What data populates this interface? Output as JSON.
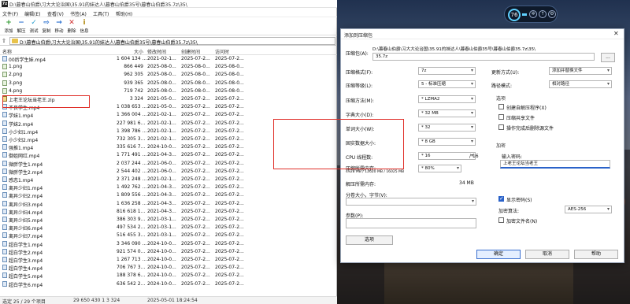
{
  "file_manager": {
    "title": "D:\\暮春山伯爵\\习大大论治国\\35.91的妹达人\\暮春山伯爵35号\\暮春山伯爵35.7z\\35\\",
    "menu": [
      "文件(F)",
      "编辑(E)",
      "查看(V)",
      "书签(A)",
      "工具(T)",
      "帮助(H)"
    ],
    "toolbar": [
      {
        "label": "添加",
        "icon": "add-icon",
        "color": "#2e9a2e",
        "glyph": "+"
      },
      {
        "label": "解压",
        "icon": "extract-icon",
        "color": "#2a6fcf",
        "glyph": "−"
      },
      {
        "label": "测试",
        "icon": "test-icon",
        "color": "#2a9fd0",
        "glyph": "✓"
      },
      {
        "label": "复制",
        "icon": "copy-icon",
        "color": "#2a6fcf",
        "glyph": "⇨"
      },
      {
        "label": "移动",
        "icon": "move-icon",
        "color": "#2a6fcf",
        "glyph": "→"
      },
      {
        "label": "删除",
        "icon": "delete-icon",
        "color": "#d03030",
        "glyph": "✕"
      },
      {
        "label": "信息",
        "icon": "info-icon",
        "color": "#b08a10",
        "glyph": "i"
      }
    ],
    "path": "D:\\暮春山伯爵\\习大大论治国\\35.91的妹达人\\暮春山伯爵35号\\暮春山伯爵35.7z\\35\\",
    "columns": {
      "name": "名称",
      "size": "大小",
      "modified": "修改时间",
      "created": "创建时间",
      "accessed": "访问时"
    },
    "rows": [
      {
        "name": "00后学生妹.mp4",
        "size": "1 604 134 ...",
        "modified": "2021-02-1...",
        "created": "2025-07-2...",
        "accessed": "2025-07-2...",
        "type": "mp4"
      },
      {
        "name": "1.png",
        "size": "866 449",
        "modified": "2025-08-0...",
        "created": "2025-08-0...",
        "accessed": "2025-08-0...",
        "type": "png"
      },
      {
        "name": "2.png",
        "size": "962 305",
        "modified": "2025-08-0...",
        "created": "2025-08-0...",
        "accessed": "2025-08-0...",
        "type": "png"
      },
      {
        "name": "3.png",
        "size": "939 365",
        "modified": "2025-08-0...",
        "created": "2025-08-0...",
        "accessed": "2025-08-0...",
        "type": "png"
      },
      {
        "name": "4.png",
        "size": "719 742",
        "modified": "2025-08-0...",
        "created": "2025-08-0...",
        "accessed": "2025-08-0...",
        "type": "png"
      },
      {
        "name": "上老王论坛当老王.zip",
        "size": "3 324",
        "modified": "2021-05-0...",
        "created": "2025-07-2...",
        "accessed": "2025-07-2...",
        "type": "zip"
      },
      {
        "name": "不良学生.mp4",
        "size": "1 038 653 ...",
        "modified": "2021-05-0...",
        "created": "2025-07-2...",
        "accessed": "2025-07-2...",
        "type": "mp4"
      },
      {
        "name": "学妹1.mp4",
        "size": "1 366 004 ...",
        "modified": "2021-02-1...",
        "created": "2025-07-2...",
        "accessed": "2025-07-2...",
        "type": "mp4"
      },
      {
        "name": "学妹2.mp4",
        "size": "227 981 6...",
        "modified": "2021-02-1...",
        "created": "2025-07-2...",
        "accessed": "2025-07-2...",
        "type": "mp4"
      },
      {
        "name": "小少妇1.mp4",
        "size": "1 398 786 ...",
        "modified": "2021-02-1...",
        "created": "2025-07-2...",
        "accessed": "2025-07-2...",
        "type": "mp4"
      },
      {
        "name": "小少妇2.mp4",
        "size": "732 305 3...",
        "modified": "2021-02-1...",
        "created": "2025-07-2...",
        "accessed": "2025-07-2...",
        "type": "mp4"
      },
      {
        "name": "强推1.mp4",
        "size": "335 616 7...",
        "modified": "2024-10-0...",
        "created": "2025-07-2...",
        "accessed": "2025-07-2...",
        "type": "mp4"
      },
      {
        "name": "御姐网红.mp4",
        "size": "1 771 491 ...",
        "modified": "2021-04-3...",
        "created": "2025-07-2...",
        "accessed": "2025-07-2...",
        "type": "mp4"
      },
      {
        "name": "微胖学生1.mp4",
        "size": "2 037 244 ...",
        "modified": "2021-06-0...",
        "created": "2025-07-2...",
        "accessed": "2025-07-2...",
        "type": "mp4"
      },
      {
        "name": "微胖学生2.mp4",
        "size": "2 544 402 ...",
        "modified": "2021-06-0...",
        "created": "2025-07-2...",
        "accessed": "2025-07-2...",
        "type": "mp4"
      },
      {
        "name": "感恋1.mp4",
        "size": "2 371 248 ...",
        "modified": "2021-02-1...",
        "created": "2025-07-2...",
        "accessed": "2025-07-2...",
        "type": "mp4"
      },
      {
        "name": "离异少妇1.mp4",
        "size": "1 492 762 ...",
        "modified": "2021-04-3...",
        "created": "2025-07-2...",
        "accessed": "2025-07-2...",
        "type": "mp4"
      },
      {
        "name": "离异少妇2.mp4",
        "size": "1 809 556 ...",
        "modified": "2021-04-3...",
        "created": "2025-07-2...",
        "accessed": "2025-07-2...",
        "type": "mp4"
      },
      {
        "name": "离异少妇3.mp4",
        "size": "1 636 258 ...",
        "modified": "2021-04-3...",
        "created": "2025-07-2...",
        "accessed": "2025-07-2...",
        "type": "mp4"
      },
      {
        "name": "离异少妇4.mp4",
        "size": "816 618 1...",
        "modified": "2021-04-3...",
        "created": "2025-07-2...",
        "accessed": "2025-07-2...",
        "type": "mp4"
      },
      {
        "name": "离异少妇5.mp4",
        "size": "386 303 9...",
        "modified": "2021-03-1...",
        "created": "2025-07-2...",
        "accessed": "2025-07-2...",
        "type": "mp4"
      },
      {
        "name": "离异少妇6.mp4",
        "size": "497 534 2...",
        "modified": "2021-03-1...",
        "created": "2025-07-2...",
        "accessed": "2025-07-2...",
        "type": "mp4"
      },
      {
        "name": "离异少妇7.mp4",
        "size": "516 455 3...",
        "modified": "2021-03-1...",
        "created": "2025-07-2...",
        "accessed": "2025-07-2...",
        "type": "mp4"
      },
      {
        "name": "超白学生1.mp4",
        "size": "3 346 090 ...",
        "modified": "2024-10-0...",
        "created": "2025-07-2...",
        "accessed": "2025-07-2...",
        "type": "mp4"
      },
      {
        "name": "超白学生2.mp4",
        "size": "921 574 0...",
        "modified": "2024-10-0...",
        "created": "2025-07-2...",
        "accessed": "2025-07-2...",
        "type": "mp4"
      },
      {
        "name": "超白学生3.mp4",
        "size": "1 267 713 ...",
        "modified": "2024-10-0...",
        "created": "2025-07-2...",
        "accessed": "2025-07-2...",
        "type": "mp4"
      },
      {
        "name": "超白学生4.mp4",
        "size": "706 767 3...",
        "modified": "2024-10-0...",
        "created": "2025-07-2...",
        "accessed": "2025-07-2...",
        "type": "mp4"
      },
      {
        "name": "超白学生5.mp4",
        "size": "188 378 6...",
        "modified": "2024-10-0...",
        "created": "2025-07-2...",
        "accessed": "2025-07-2...",
        "type": "mp4"
      },
      {
        "name": "超白学生6.mp4",
        "size": "636 542 2...",
        "modified": "2024-10-0...",
        "created": "2025-07-2...",
        "accessed": "2025-07-2...",
        "type": "mp4"
      }
    ],
    "status": {
      "selection": "选定 25 / 29 个项目",
      "size": "29 650 430 1 3 324",
      "date": "2025-05-01 18:24:54"
    }
  },
  "dialog": {
    "title": "添加到压缩包",
    "archive_label": "压缩包(A):",
    "archive_path": "D:\\暮春山伯爵\\习大大论治国\\35.91的妹达人\\暮春山伯爵35号\\暮春山伯爵35.7z\\35\\",
    "archive_name": "35.7z",
    "browse_label": "...",
    "format_label": "压缩格式(F):",
    "format_value": "7z",
    "level_label": "压缩等级(L):",
    "level_value": "5 - 标准压缩",
    "method_label": "压缩方法(M):",
    "method_value": "* LZMA2",
    "dict_label": "字典大小(D):",
    "dict_value": "* 32 MB",
    "word_label": "单词大小(W):",
    "word_value": "* 32",
    "solid_label": "固实数据大小:",
    "solid_value": "* 8 GB",
    "threads_label": "CPU 线程数:",
    "threads_value": "* 16",
    "threads_total": "/ 16",
    "mem_label": "压缩所需内存:",
    "mem_detail": "4928 MB / 12620 MB / 16025 MB",
    "mem_value": "* 80%",
    "decomp_label": "解压所需内存:",
    "decomp_value": "34 MB",
    "split_label": "分卷大小，字节(V):",
    "params_label": "参数(P):",
    "options_btn": "选项",
    "update_label": "更新方式(U):",
    "update_value": "添加并替换文件",
    "path_label": "路径模式:",
    "path_value": "相对路径",
    "options_group": "选项",
    "opt_sfx": "创建自解压程序(X)",
    "opt_shared": "压缩共享文件",
    "opt_delete": "操作完成后删除源文件",
    "enc_group": "加密",
    "pw_label": "输入密码:",
    "pw_value": "上老王论坛当老王",
    "show_pw": "显示密码(S)",
    "enc_method_label": "加密算法:",
    "enc_method_value": "AES-256",
    "enc_names": "加密文件名(N)",
    "ok": "确定",
    "cancel": "取消",
    "help": "帮助",
    "close_icon": "close-icon"
  },
  "widget": {
    "percent": "76"
  },
  "colors": {
    "highlight": "#e0302a",
    "accent": "#2a62c9"
  }
}
